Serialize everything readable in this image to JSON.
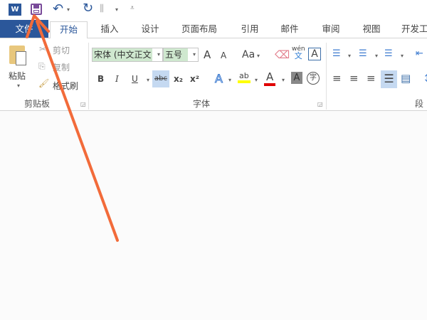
{
  "qat": {
    "icons": [
      "word-logo-icon",
      "save-icon",
      "undo-icon",
      "redo-icon",
      "touch-mode-icon",
      "customize-icon"
    ]
  },
  "tabs": [
    "文件",
    "开始",
    "插入",
    "设计",
    "页面布局",
    "引用",
    "邮件",
    "审阅",
    "视图",
    "开发工"
  ],
  "clipboard": {
    "paste": "粘贴",
    "cut": "剪切",
    "copy": "复制",
    "format_painter": "格式刷",
    "label": "剪贴板"
  },
  "font": {
    "name": "宋体 (中文正文",
    "size": "五号",
    "grow": "A",
    "shrink": "A",
    "case": "Aa",
    "pinyin_top": "wén",
    "pinyin_bottom": "文",
    "border_char": "A",
    "bold": "B",
    "italic": "I",
    "underline": "U",
    "strike": "abc",
    "sub": "x₂",
    "sup": "x²",
    "effects": "A",
    "highlight": "ab",
    "color": "A",
    "shading": "A",
    "enclose": "字",
    "label": "字体"
  },
  "paragraph": {
    "label": "段落"
  },
  "colors": {
    "file_tab": "#2b579a",
    "arrow": "#f26b3a",
    "highlight": "#ffff00",
    "font_color": "#e00000"
  }
}
